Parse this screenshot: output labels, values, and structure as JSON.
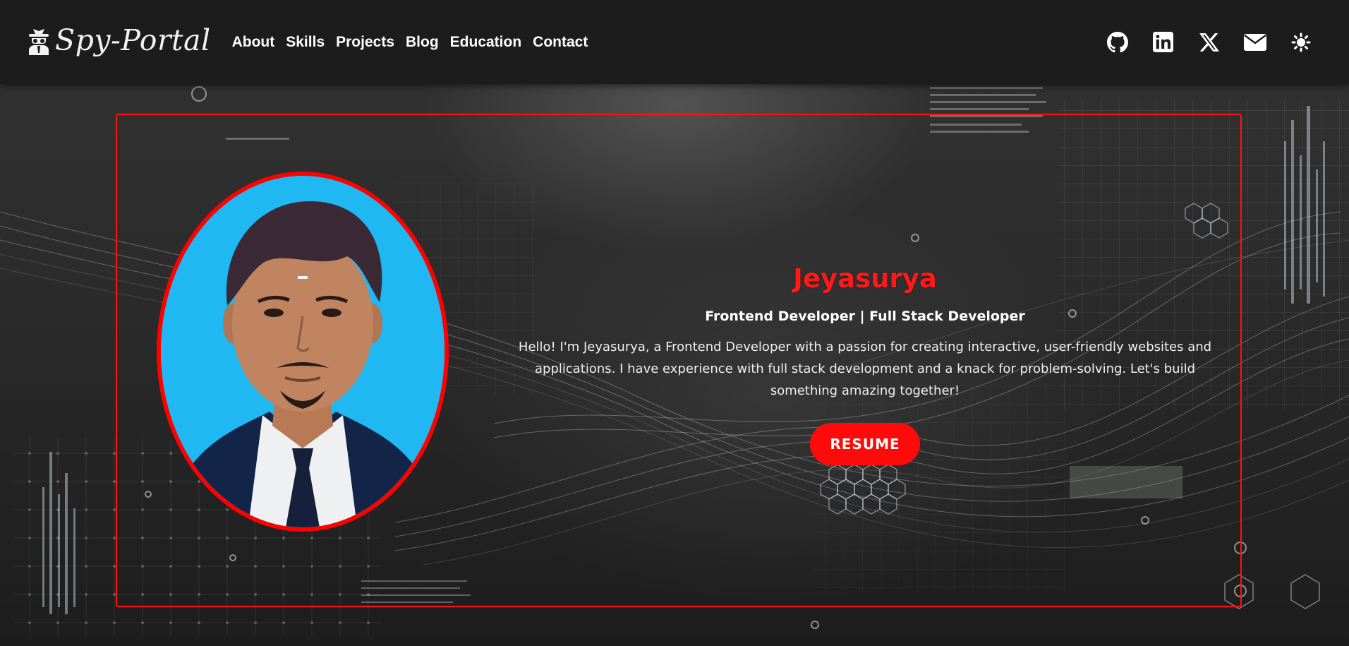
{
  "brand": {
    "name": "Spy-Portal",
    "icon": "spy-icon"
  },
  "nav": {
    "links": [
      {
        "label": "About"
      },
      {
        "label": "Skills"
      },
      {
        "label": "Projects"
      },
      {
        "label": "Blog"
      },
      {
        "label": "Education"
      },
      {
        "label": "Contact"
      }
    ],
    "icons": [
      "github-icon",
      "linkedin-icon",
      "x-icon",
      "email-icon",
      "theme-toggle-icon"
    ]
  },
  "hero": {
    "name": "Jeyasurya",
    "role": "Frontend Developer | Full Stack Developer",
    "description": "Hello! I'm Jeyasurya, a Frontend Developer with a passion for creating interactive, user-friendly websites and applications. I have experience with full stack development and a knack for problem-solving. Let's build something amazing together!",
    "resume_label": "RESUME"
  },
  "colors": {
    "accent": "#ff0a0a",
    "navbar_bg": "#1c1c1c",
    "photo_bg": "#1fb8f2"
  }
}
